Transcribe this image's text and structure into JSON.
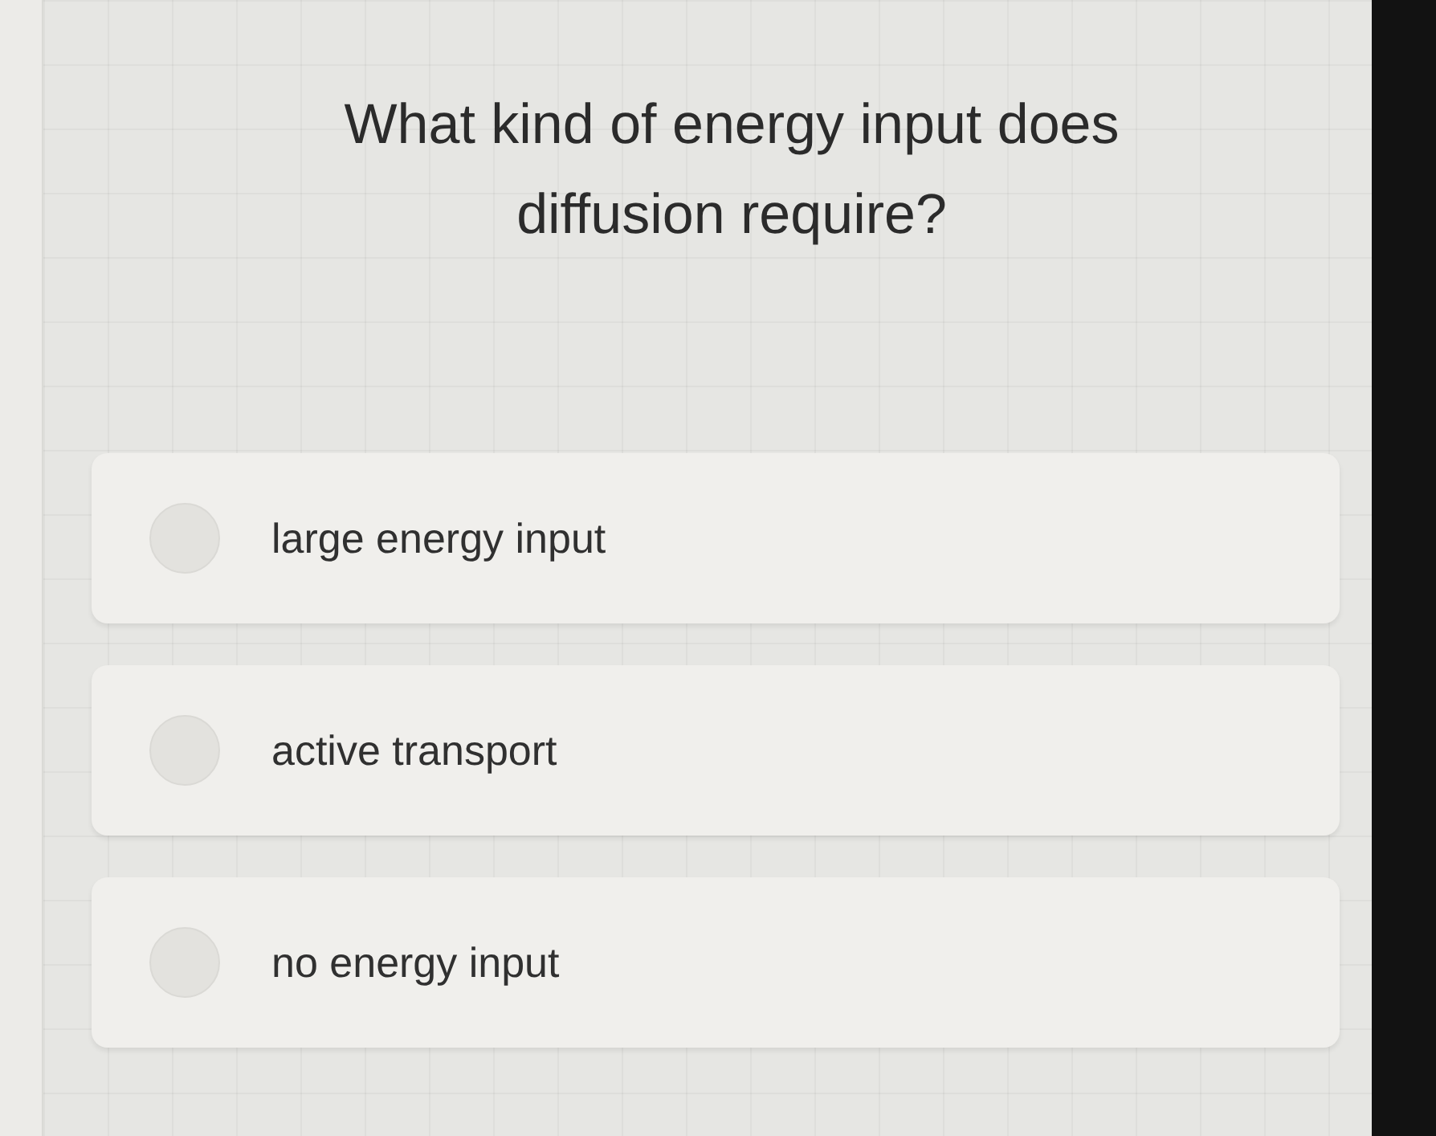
{
  "question": "What kind of energy input does diffusion require?",
  "options": [
    {
      "label": "large energy input",
      "selected": false
    },
    {
      "label": "active transport",
      "selected": false
    },
    {
      "label": "no energy input",
      "selected": false
    }
  ]
}
